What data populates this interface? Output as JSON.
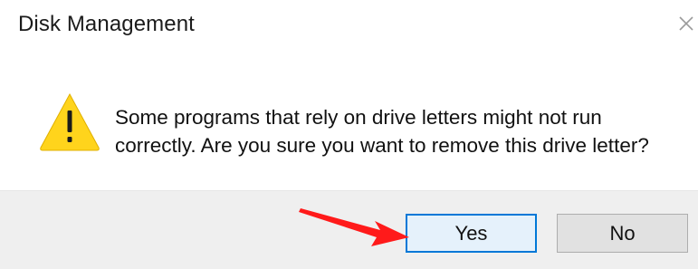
{
  "window": {
    "title": "Disk Management",
    "close_icon": "close-icon"
  },
  "content": {
    "icon": "warning-icon",
    "message": "Some programs that rely on drive letters might not run correctly. Are you sure you want to remove this drive letter?"
  },
  "buttons": {
    "yes_label": "Yes",
    "no_label": "No"
  },
  "annotation": {
    "icon": "red-arrow-icon",
    "color": "#ff1a1a"
  },
  "colors": {
    "focus_border": "#0078d7",
    "footer_bg": "#efefef",
    "warning_yellow": "#ffd41c"
  }
}
